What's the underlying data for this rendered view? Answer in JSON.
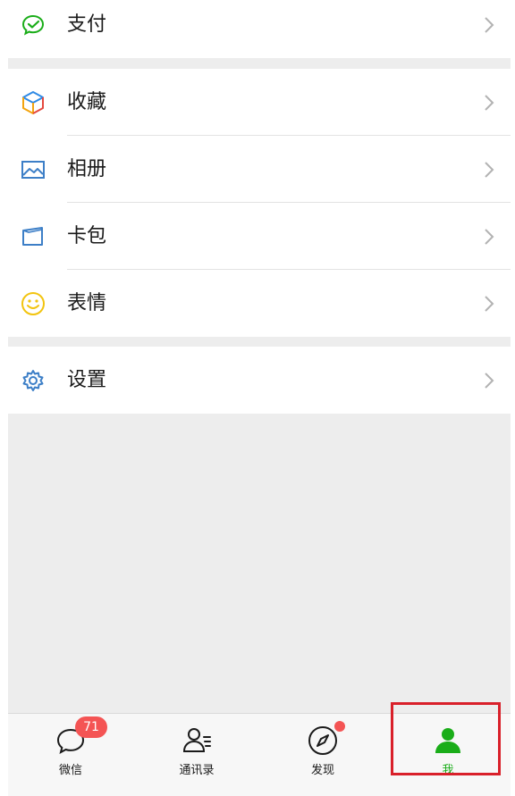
{
  "menu": {
    "pay": {
      "label": "支付",
      "icon": "wechat-pay-icon"
    },
    "favorites": {
      "label": "收藏",
      "icon": "cube-icon"
    },
    "album": {
      "label": "相册",
      "icon": "image-icon"
    },
    "cards": {
      "label": "卡包",
      "icon": "card-icon"
    },
    "stickers": {
      "label": "表情",
      "icon": "smiley-icon"
    },
    "settings": {
      "label": "设置",
      "icon": "gear-icon"
    }
  },
  "tabbar": {
    "chats": {
      "label": "微信",
      "badge": "71",
      "icon": "chat-bubble-icon"
    },
    "contacts": {
      "label": "通讯录",
      "icon": "contacts-icon"
    },
    "discover": {
      "label": "发现",
      "icon": "compass-icon"
    },
    "me": {
      "label": "我",
      "icon": "person-icon"
    }
  },
  "colors": {
    "accent": "#1aad19",
    "badge": "#f45454",
    "highlight": "#d9202a",
    "background": "#ededed"
  }
}
